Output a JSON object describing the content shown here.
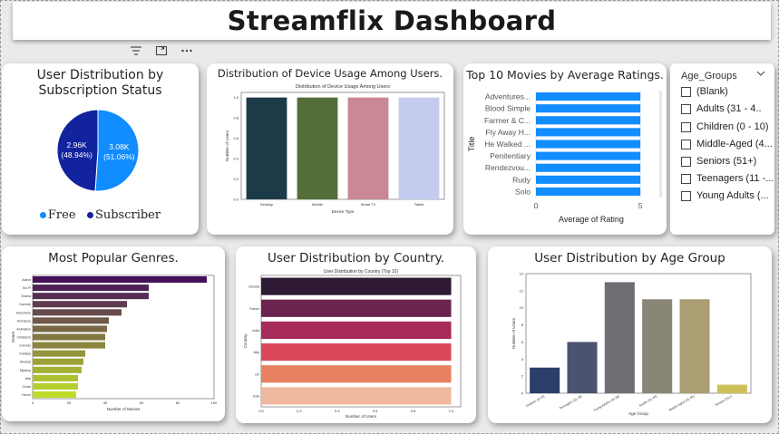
{
  "dashboard": {
    "title": "Streamflix Dashboard"
  },
  "subscription": {
    "title_line1": "User Distribution by",
    "title_line2": "Subscription Status",
    "slices": [
      {
        "label": "Free",
        "value_text": "3.08K",
        "pct_text": "(51.06%)",
        "fraction": 0.5106,
        "color": "#118dff"
      },
      {
        "label": "Subscriber",
        "value_text": "2.96K",
        "pct_text": "(48.94%)",
        "fraction": 0.4894,
        "color": "#12239e"
      }
    ]
  },
  "device_card": {
    "title": "Distribution of Device Usage Among Users.",
    "inner_title": "Distribution of Device Usage Among Users",
    "xlabel": "Device Type",
    "ylabel": "Number of Users"
  },
  "movies_card": {
    "title": "Top 10 Movies by Average Ratings.",
    "ylabel": "Title",
    "xlabel": "Average of Rating",
    "tick0": "0",
    "tick5": "5"
  },
  "slicer": {
    "title": "Age_Groups",
    "items": [
      "(Blank)",
      "Adults (31 - 4..",
      "Children (0 - 10)",
      "Middle-Aged (4...",
      "Seniors (51+)",
      "Teenagers (11 -...",
      "Young Adults (..."
    ]
  },
  "genres_card": {
    "title": "Most Popular Genres.",
    "ylabel": "Genre",
    "xlabel": "Number of Movies"
  },
  "country_card": {
    "title": "User Distribution by Country.",
    "inner_title": "User Distribution by Country (Top 10)",
    "ylabel": "Country",
    "xlabel": "Number of Users"
  },
  "age_card": {
    "title": "User Distribution by Age Group",
    "ylabel": "Number of Users",
    "xlabel": "Age Group"
  },
  "chart_data": [
    {
      "type": "bar",
      "id": "device",
      "categories": [
        "Desktop",
        "Mobile",
        "Smart TV",
        "Tablet"
      ],
      "values": [
        1.0,
        1.0,
        1.0,
        1.0
      ],
      "colors": [
        "#1d3a49",
        "#546e3a",
        "#c98893",
        "#c4cbee"
      ],
      "title": "Distribution of Device Usage Among Users",
      "xlabel": "Device Type",
      "ylabel": "Number of Users",
      "ylim": [
        0,
        1.05
      ],
      "yticks": [
        "0.0",
        "0.2",
        "0.4",
        "0.6",
        "0.8",
        "1.0"
      ]
    },
    {
      "type": "bar",
      "id": "movies",
      "orientation": "horizontal",
      "categories": [
        "Adventures...",
        "Blood Simple",
        "Farmer & C...",
        "Fly Away H...",
        "He Walked ...",
        "Penitentiary",
        "Rendezvou...",
        "Rudy",
        "Solo"
      ],
      "values": [
        5,
        5,
        5,
        5,
        5,
        5,
        5,
        5,
        5
      ],
      "color": "#118dff",
      "xlabel": "Average of Rating",
      "ylabel": "Title",
      "xlim": [
        0,
        5.3
      ]
    },
    {
      "type": "bar",
      "id": "genres",
      "orientation": "horizontal",
      "categories": [
        "Action",
        "Sci-Fi",
        "Drama",
        "Comedy",
        "Adventure",
        "Romance",
        "Animation",
        "Children's",
        "Comedy",
        "Fantasy",
        "Musical",
        "Mystery",
        "War",
        "Crime",
        "Horror"
      ],
      "values": [
        96,
        64,
        64,
        52,
        49,
        42,
        41,
        40,
        40,
        29,
        28,
        27,
        25,
        25,
        24
      ],
      "color_from": "#46105a",
      "color_to": "#bedd2a",
      "xlabel": "Number of Movies",
      "ylabel": "Genre",
      "xlim": [
        0,
        100
      ],
      "xticks": [
        "0",
        "20",
        "40",
        "60",
        "80",
        "100"
      ]
    },
    {
      "type": "bar",
      "id": "country",
      "orientation": "horizontal",
      "categories": [
        "Canada",
        "France",
        "India",
        "Italy",
        "UK",
        "USA"
      ],
      "values": [
        1.0,
        1.0,
        1.0,
        1.0,
        1.0,
        1.0
      ],
      "colors": [
        "#2e1a34",
        "#6b2450",
        "#a62a5a",
        "#d8485a",
        "#e58061",
        "#efb89f"
      ],
      "title": "User Distribution by Country (Top 10)",
      "xlabel": "Number of Users",
      "ylabel": "Country",
      "xlim": [
        0,
        1.05
      ],
      "xticks": [
        "0.0",
        "0.2",
        "0.4",
        "0.6",
        "0.8",
        "1.0"
      ]
    },
    {
      "type": "bar",
      "id": "age",
      "categories": [
        "Children (0-10)",
        "Teenagers (11-18)",
        "Young Adults (19-30)",
        "Adults (31-40)",
        "Middle-Aged (41-50)",
        "Seniors (51+)"
      ],
      "values": [
        3,
        6,
        13,
        11,
        11,
        1
      ],
      "colors": [
        "#2c3e6a",
        "#4a5470",
        "#6e6e74",
        "#8a8676",
        "#aa9e72",
        "#cfc15a"
      ],
      "xlabel": "Age Group",
      "ylabel": "Number of Users",
      "ylim": [
        0,
        14
      ],
      "yticks": [
        "0",
        "2",
        "4",
        "6",
        "8",
        "10",
        "12",
        "14"
      ]
    }
  ]
}
